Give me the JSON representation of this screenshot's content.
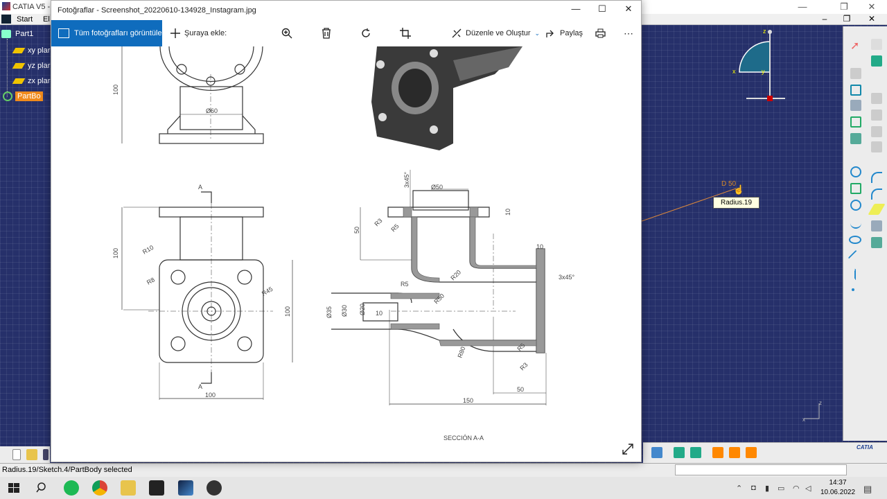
{
  "catia": {
    "title": "CATIA V5 - [",
    "menu": {
      "start": "Start",
      "edit": "El"
    },
    "tree": {
      "root": "Part1",
      "items": [
        "xy plar",
        "yz plar",
        "zx plar"
      ],
      "partbody": "PartBo"
    },
    "tooltip": "Radius.19",
    "dimension": "D 50",
    "status": "Radius.19/Sketch.4/PartBody selected",
    "compass": {
      "z": "z",
      "x": "x",
      "y": "y"
    },
    "corner_axis": {
      "z": "z",
      "x": "x"
    },
    "brand": "CATIA"
  },
  "photos": {
    "title": "Fotoğraflar - Screenshot_20220610-134928_Instagram.jpg",
    "toolbar": {
      "view_all": "Tüm fotoğrafları görüntüle",
      "add": "Şuraya ekle:",
      "edit_create": "Düzenle ve Oluştur",
      "share": "Paylaş"
    },
    "drawing": {
      "dim_100_top": "100",
      "dim_60": "Ø60",
      "dim_100_left": "100",
      "dim_R10": "R10",
      "dim_R8": "R8",
      "dim_R45": "R45",
      "dim_100_right": "100",
      "dim_100_bottom": "100",
      "section_mark": "A",
      "dim_3x45_top": "3x45°",
      "dim_50_top": "Ø50",
      "dim_10_top": "10",
      "dim_50_left": "50",
      "dim_R3a": "R3",
      "dim_R5a": "R5",
      "dim_10_right": "10",
      "dim_3x45_right": "3x45°",
      "dim_R5b": "R5",
      "dim_R20": "R20",
      "dim_R50": "R50",
      "dim_35": "Ø35",
      "dim_30": "Ø30",
      "dim_20": "Ø20",
      "dim_10_mid": "10",
      "dim_R80": "R80",
      "dim_R5c": "R5",
      "dim_R3b": "R3",
      "dim_50_bottom": "50",
      "dim_150": "150",
      "section_label": "SECCIÓN A-A"
    }
  },
  "taskbar": {
    "time": "14:37",
    "date": "10.06.2022"
  }
}
